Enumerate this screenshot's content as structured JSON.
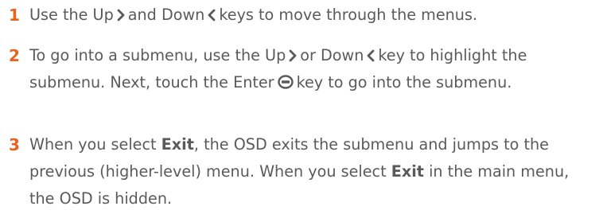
{
  "steps": [
    {
      "number": "1",
      "t1": "Use the Up",
      "t2": "and Down",
      "t3": "keys to move through the menus."
    },
    {
      "number": "2",
      "t1": "To go into a submenu, use the Up",
      "t2": "or Down",
      "t3": "key to highlight the submenu. Next, touch the Enter",
      "t4": "key to go into the submenu."
    },
    {
      "number": "3",
      "t1": "When you select",
      "b1": "Exit",
      "t2": ", the OSD exits the submenu and jumps to the previous (higher-level) menu. When you select",
      "b2": "Exit",
      "t3": "in the main menu, the OSD is hidden."
    }
  ],
  "icons": {
    "up": "chevron-right-icon",
    "down": "chevron-left-icon",
    "enter": "enter-key-icon"
  },
  "colors": {
    "number": "#e8641e",
    "text": "#5a5a5a"
  }
}
